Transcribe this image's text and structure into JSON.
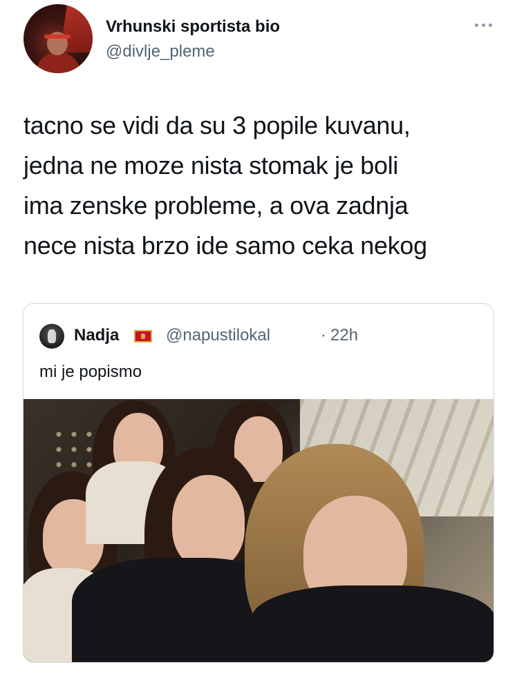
{
  "tweet": {
    "author": {
      "display_name": "Vrhunski sportista bio",
      "handle": "@divlje_pleme",
      "avatar_icon": "profile-avatar"
    },
    "more_icon": "more-horizontal-icon",
    "text": "tacno se vidi da su 3 popile kuvanu,\njedna ne moze nista stomak je boli\nima zenske probleme, a ova zadnja\nnece nista brzo ide samo ceka nekog"
  },
  "quoted_tweet": {
    "display_name": "Nadja",
    "flag_icon": "montenegro-flag-icon",
    "handle": "@napustilokal",
    "separator": "·",
    "time": "22h",
    "text": "mi je popismo",
    "media": "photo-selfie-group"
  },
  "colors": {
    "text_primary": "#0f1419",
    "text_secondary": "#536471",
    "border": "#cfd9de"
  }
}
